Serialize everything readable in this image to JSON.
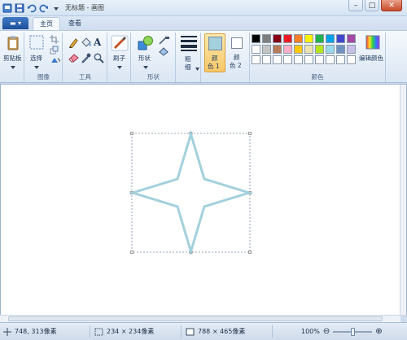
{
  "window": {
    "title": "无标题 - 画图",
    "min_label": "–",
    "max_label": "□",
    "close_label": "✕"
  },
  "quick_access": {
    "save_icon": "save-icon",
    "undo_icon": "undo-icon",
    "redo_icon": "redo-icon"
  },
  "tabs": {
    "app_menu": "▬ ▾",
    "home": "主页",
    "view": "查看"
  },
  "ribbon": {
    "clipboard": {
      "label": "剪贴板"
    },
    "image": {
      "select_label": "选择",
      "group_label": "图像"
    },
    "tools": {
      "text_glyph": "A",
      "group_label": "工具"
    },
    "brushes": {
      "label": "刷子"
    },
    "shapes": {
      "shapes_label": "形状",
      "group_label": "形状"
    },
    "size": {
      "label_line1": "粗",
      "label_line2": "细"
    },
    "color1": {
      "label_line1": "颜",
      "label_line2": "色 1",
      "color": "#a3d0dd"
    },
    "color2": {
      "label_line1": "颜",
      "label_line2": "色 2",
      "color": "#ffffff"
    },
    "colors": {
      "group_label": "颜色",
      "edit_label": "编辑颜色",
      "palette_row1": [
        "#000000",
        "#7f7f7f",
        "#880015",
        "#ed1c24",
        "#ff7f27",
        "#fff200",
        "#22b14c",
        "#00a2e8",
        "#3f48cc",
        "#a349a4"
      ],
      "palette_row2": [
        "#ffffff",
        "#c3c3c3",
        "#b97a57",
        "#ffaec9",
        "#ffc90e",
        "#efe4b0",
        "#b5e61d",
        "#99d9ea",
        "#7092be",
        "#c8bfe7"
      ],
      "palette_row3": [
        "#ffffff",
        "#ffffff",
        "#ffffff",
        "#ffffff",
        "#ffffff",
        "#ffffff",
        "#ffffff",
        "#ffffff",
        "#ffffff",
        "#ffffff"
      ]
    }
  },
  "drawing": {
    "stroke_color": "#a3d0dd",
    "shape": "four-point-star"
  },
  "status": {
    "cursor_pos": "748, 313像素",
    "selection_size": "234 × 234像素",
    "canvas_size": "788 × 465像素",
    "zoom": "100%",
    "zoom_out": "⊖",
    "zoom_in": "⊕",
    "zoom_level": 1.0
  }
}
